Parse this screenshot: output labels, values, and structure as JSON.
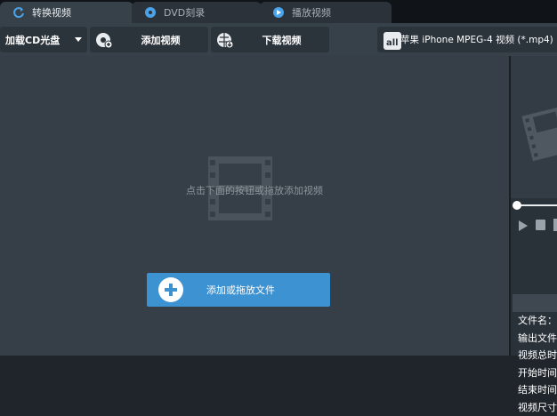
{
  "tabs": [
    {
      "label": "转换视频",
      "icon": "refresh-icon"
    },
    {
      "label": "DVD刻录",
      "icon": "disc-icon"
    },
    {
      "label": "播放视频",
      "icon": "play-icon"
    }
  ],
  "toolbar": {
    "load_cd_label": "加载CD光盘",
    "add_video_label": "添加视频",
    "download_video_label": "下载视频",
    "format_label": "苹果 iPhone MPEG-4 视频 (*.mp4)",
    "format_icon": "all-formats-icon"
  },
  "main": {
    "hint": "点击下面的按钮或拖放添加视频",
    "add_button_label": "添加或拖放文件"
  },
  "info": {
    "rows": [
      "文件名：",
      "输出文件",
      "视频总时",
      "开始时间",
      "结束时间",
      "视频尺寸"
    ]
  },
  "colors": {
    "accent": "#3d92d1",
    "toolbar": "#374149",
    "main_bg": "#363f47"
  }
}
